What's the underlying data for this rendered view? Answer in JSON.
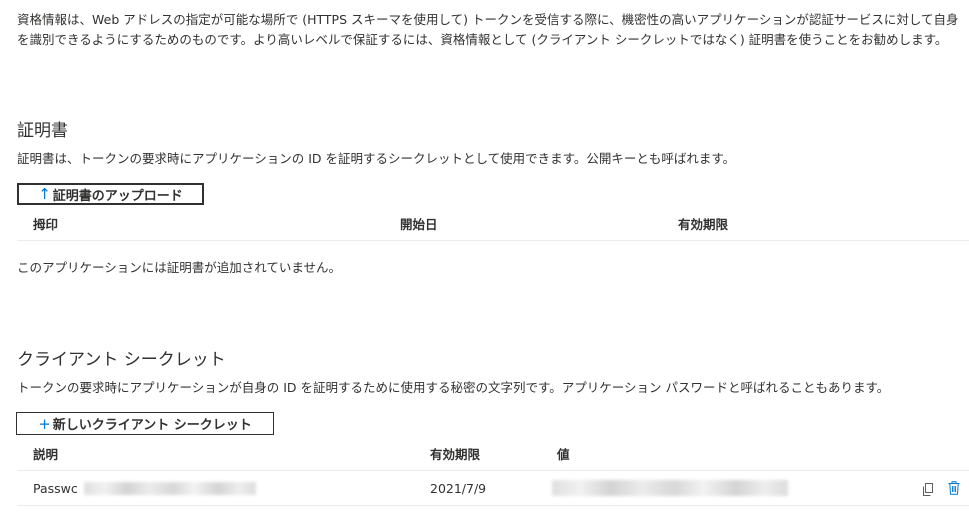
{
  "intro_text": "資格情報は、Web アドレスの指定が可能な場所で (HTTPS スキーマを使用して) トークンを受信する際に、機密性の高いアプリケーションが認証サービスに対して自身を識別できるようにするためのものです。より高いレベルで保証するには、資格情報として (クライアント シークレットではなく) 証明書を使うことをお勧めします。",
  "certificates": {
    "title": "証明書",
    "description": "証明書は、トークンの要求時にアプリケーションの ID を証明するシークレットとして使用できます。公開キーとも呼ばれます。",
    "upload_label": "証明書のアップロード",
    "columns": [
      "拇印",
      "開始日",
      "有効期限"
    ],
    "empty_text": "このアプリケーションには証明書が追加されていません。"
  },
  "client_secrets": {
    "title": "クライアント シークレット",
    "description": "トークンの要求時にアプリケーションが自身の ID を証明するために使用する秘密の文字列です。アプリケーション パスワードと呼ばれることもあります。",
    "new_label": "新しいクライアント シークレット",
    "columns": [
      "説明",
      "有効期限",
      "値"
    ],
    "rows": [
      {
        "description": "Passwc",
        "expires": "2021/7/9"
      }
    ]
  },
  "icons": {
    "upload": "upload-arrow-icon",
    "add": "plus-icon",
    "copy": "copy-icon",
    "delete": "trash-icon"
  },
  "colors": {
    "accent": "#0078d4",
    "text": "#323130",
    "divider": "#edebe9"
  }
}
